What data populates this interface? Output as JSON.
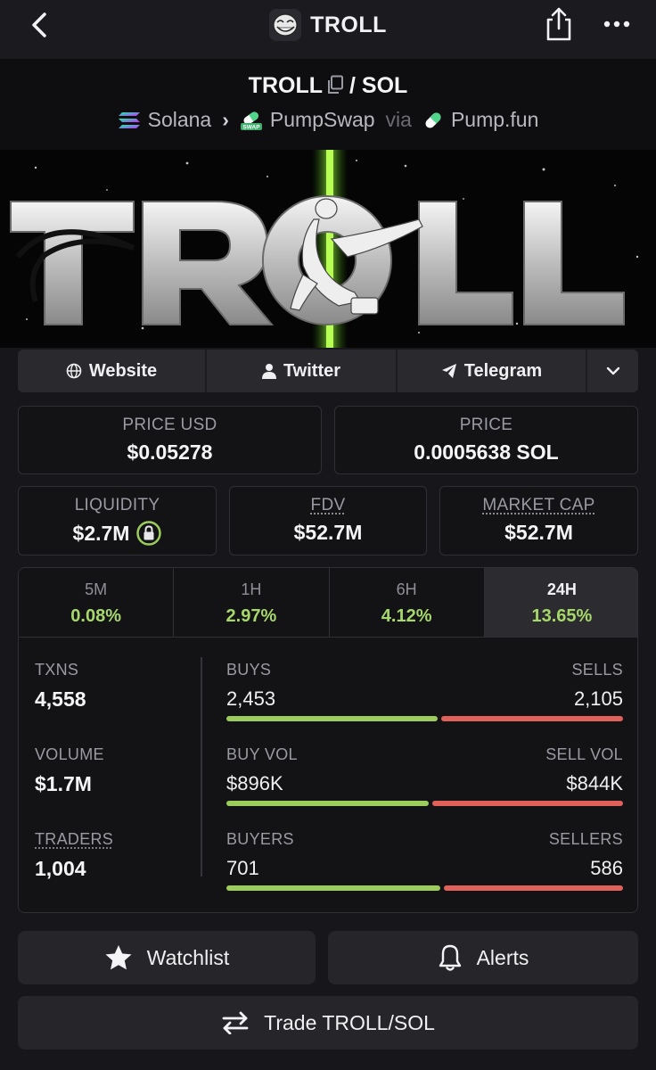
{
  "header": {
    "title": "TROLL"
  },
  "pair": {
    "base": "TROLL",
    "separator": "/",
    "quote": "SOL",
    "chain": "Solana",
    "dex": "PumpSwap",
    "via": "via",
    "launchpad": "Pump.fun",
    "dex_badge": "SWAP"
  },
  "banner": {
    "text": "TROLL"
  },
  "links": {
    "website": "Website",
    "twitter": "Twitter",
    "telegram": "Telegram"
  },
  "prices": {
    "price_usd_label": "PRICE USD",
    "price_usd": "$0.05278",
    "price_label": "PRICE",
    "price": "0.0005638 SOL"
  },
  "metrics": {
    "liquidity_label": "LIQUIDITY",
    "liquidity": "$2.7M",
    "fdv_label": "FDV",
    "fdv": "$52.7M",
    "mcap_label": "MARKET CAP",
    "mcap": "$52.7M"
  },
  "tabs": [
    {
      "label": "5M",
      "change": "0.08%"
    },
    {
      "label": "1H",
      "change": "2.97%"
    },
    {
      "label": "6H",
      "change": "4.12%"
    },
    {
      "label": "24H",
      "change": "13.65%"
    }
  ],
  "stats": {
    "txns_label": "TXNS",
    "txns": "4,558",
    "volume_label": "VOLUME",
    "volume": "$1.7M",
    "traders_label": "TRADERS",
    "traders": "1,004",
    "buys_label": "BUYS",
    "buys": "2,453",
    "sells_label": "SELLS",
    "sells": "2,105",
    "buyvol_label": "BUY VOL",
    "buyvol": "$896K",
    "sellvol_label": "SELL VOL",
    "sellvol": "$844K",
    "buyers_label": "BUYERS",
    "buyers": "701",
    "sellers_label": "SELLERS",
    "sellers": "586",
    "buy_share": 0.538,
    "buyvol_share": 0.515,
    "buyers_share": 0.545
  },
  "actions": {
    "watchlist": "Watchlist",
    "alerts": "Alerts",
    "trade": "Trade TROLL/SOL"
  },
  "colors": {
    "accent_green": "#9ccd5c",
    "accent_red": "#e0605a",
    "background": "#17171b"
  }
}
